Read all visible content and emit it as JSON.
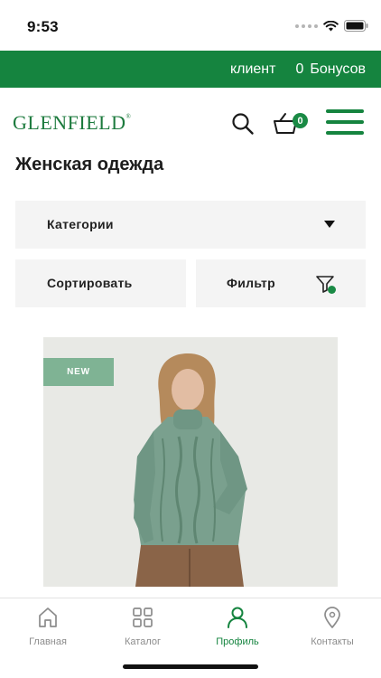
{
  "status_bar": {
    "time": "9:53"
  },
  "top_bar": {
    "user_label": "клиент",
    "bonus_count": "0",
    "bonus_label": "Бонусов"
  },
  "header": {
    "logo_text": "GLENFIELD",
    "logo_mark": "®",
    "cart_count": "0"
  },
  "page": {
    "title": "Женская одежда"
  },
  "controls": {
    "categories_label": "Категории",
    "sort_label": "Сортировать",
    "filter_label": "Фильтр"
  },
  "product": {
    "badge": "NEW"
  },
  "tabbar": {
    "tabs": [
      {
        "label": "Главная",
        "icon": "home-icon",
        "active": false
      },
      {
        "label": "Каталог",
        "icon": "grid-icon",
        "active": false
      },
      {
        "label": "Профиль",
        "icon": "user-icon",
        "active": true
      },
      {
        "label": "Контакты",
        "icon": "location-pin-icon",
        "active": false
      }
    ]
  },
  "colors": {
    "brand_green": "#15843f",
    "badge_green": "#7fb394",
    "control_bg": "#f4f4f4"
  }
}
